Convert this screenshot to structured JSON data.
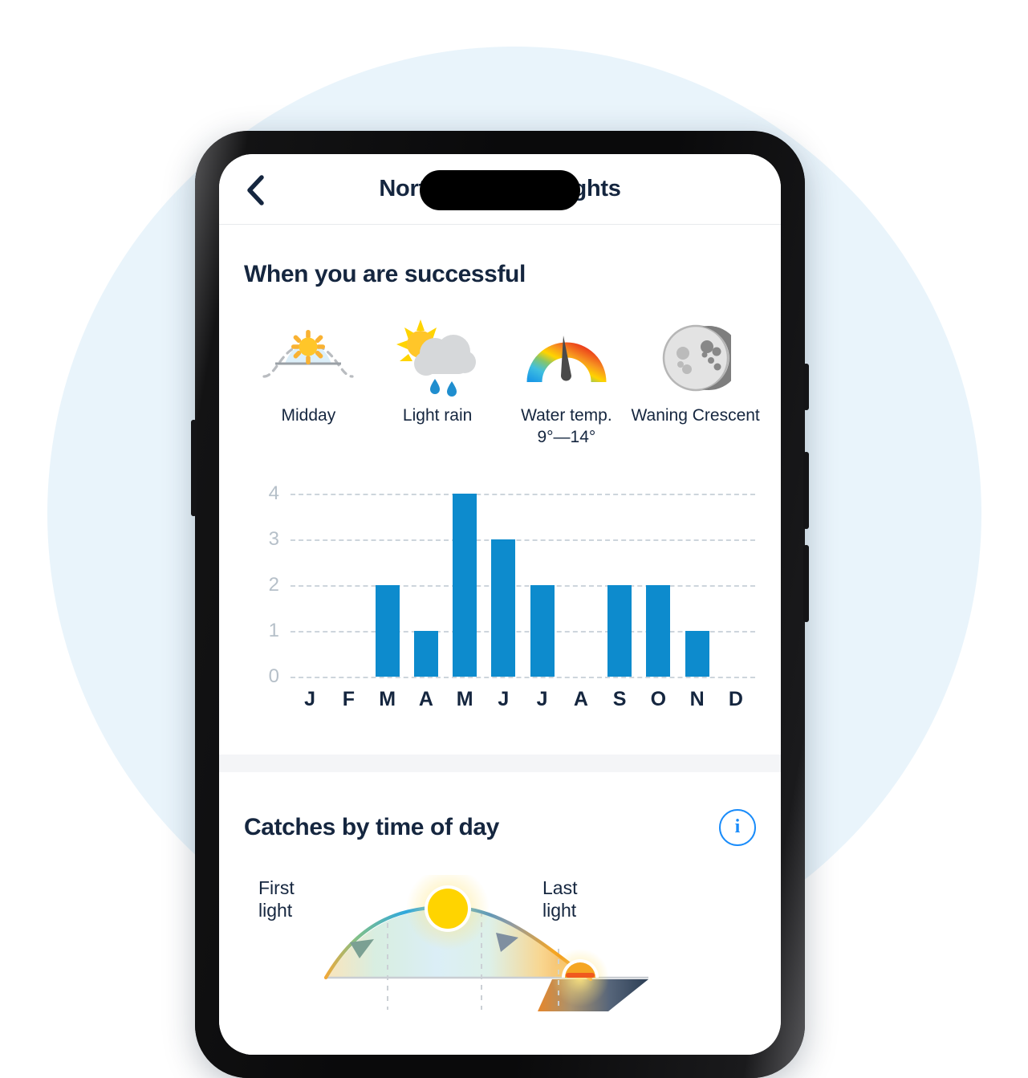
{
  "nav": {
    "back_icon": "chevron-left-icon",
    "title": "Northern pike insights"
  },
  "success": {
    "title": "When you are successful",
    "conditions": [
      {
        "icon": "midday-sun-arc-icon",
        "label": "Midday"
      },
      {
        "icon": "sun-behind-rain-cloud-icon",
        "label": "Light rain"
      },
      {
        "icon": "thermometer-gauge-icon",
        "label": "Water temp.",
        "label2": "9°—14°"
      },
      {
        "icon": "waning-crescent-moon-icon",
        "label": "Waning Crescent"
      }
    ]
  },
  "catches": {
    "title": "Catches by time of day",
    "info_icon": "info-circle-icon",
    "info_label": "i",
    "first_light": "First",
    "first_light2": "light",
    "last_light": "Last",
    "last_light2": "light",
    "sun_icon": "sun-icon",
    "sunset_icon": "setting-sun-icon"
  },
  "colors": {
    "accent_blue": "#0d8bcd",
    "info_blue": "#1a8cfa",
    "text_navy": "#15263f",
    "axis_gray": "#b6c0c9",
    "grid_gray": "#cdd5dc",
    "page_bg": "#e9f4fb",
    "separator": "#f4f5f7"
  },
  "chart_data": {
    "type": "bar",
    "title": "When you are successful",
    "categories": [
      "J",
      "F",
      "M",
      "A",
      "M",
      "J",
      "J",
      "A",
      "S",
      "O",
      "N",
      "D"
    ],
    "values": [
      0,
      0,
      2,
      1,
      4,
      3,
      2,
      0,
      2,
      2,
      1,
      0
    ],
    "ytick_labels": [
      "0",
      "1",
      "2",
      "3",
      "4"
    ],
    "ylim": [
      0,
      4
    ],
    "xlabel": "",
    "ylabel": "",
    "grid": true,
    "legend": "none",
    "series_color": "#0d8bcd"
  }
}
